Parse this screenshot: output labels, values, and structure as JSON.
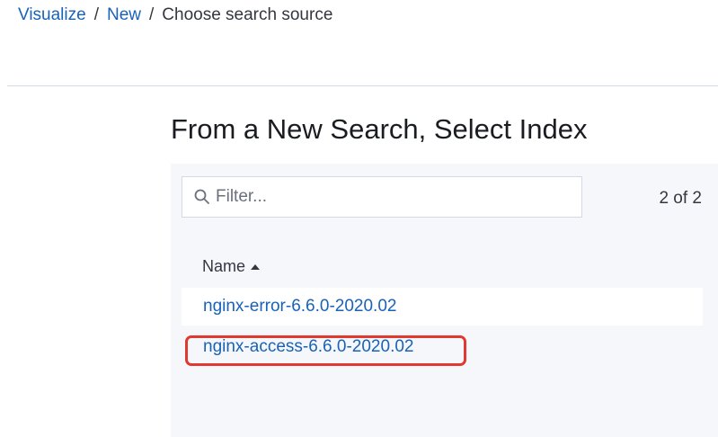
{
  "breadcrumb": {
    "items": [
      "Visualize",
      "New",
      "Choose search source"
    ],
    "separator": "/"
  },
  "page": {
    "title": "From a New Search, Select Index"
  },
  "filter": {
    "placeholder": "Filter...",
    "value": "",
    "icon": "search-icon"
  },
  "results": {
    "count_label": "2 of 2",
    "column_header": "Name",
    "sort_icon": "sort-ascending-icon",
    "rows": [
      {
        "name": "nginx-error-6.6.0-2020.02"
      },
      {
        "name": "nginx-access-6.6.0-2020.02"
      }
    ]
  },
  "annotation": {
    "highlight_color": "#e0392f",
    "highlighted_row": "nginx-access-6.6.0-2020.02"
  },
  "colors": {
    "link": "#1a62b8",
    "text": "#343741",
    "panel_bg": "#f5f7fa"
  }
}
